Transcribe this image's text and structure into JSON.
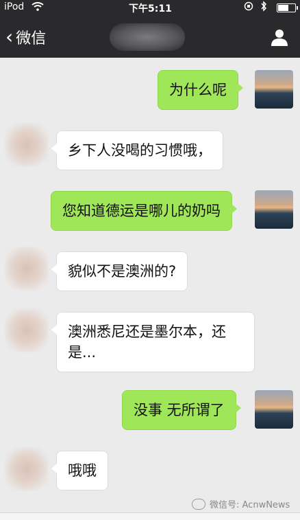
{
  "status_bar": {
    "carrier": "iPod",
    "time": "下午5:11"
  },
  "nav": {
    "back_label": "微信"
  },
  "messages": [
    {
      "from": "me",
      "text": "为什么呢"
    },
    {
      "from": "them",
      "text": "乡下人没喝的习惯哦，"
    },
    {
      "from": "me",
      "text": "您知道德运是哪儿的奶吗"
    },
    {
      "from": "them",
      "text": "貌似不是澳洲的?"
    },
    {
      "from": "them",
      "text": "澳洲悉尼还是墨尔本，还是..."
    },
    {
      "from": "me",
      "text": "没事 无所谓了"
    },
    {
      "from": "them",
      "text": "哦哦"
    }
  ],
  "watermark": {
    "text": "微信号: AcnwNews"
  }
}
